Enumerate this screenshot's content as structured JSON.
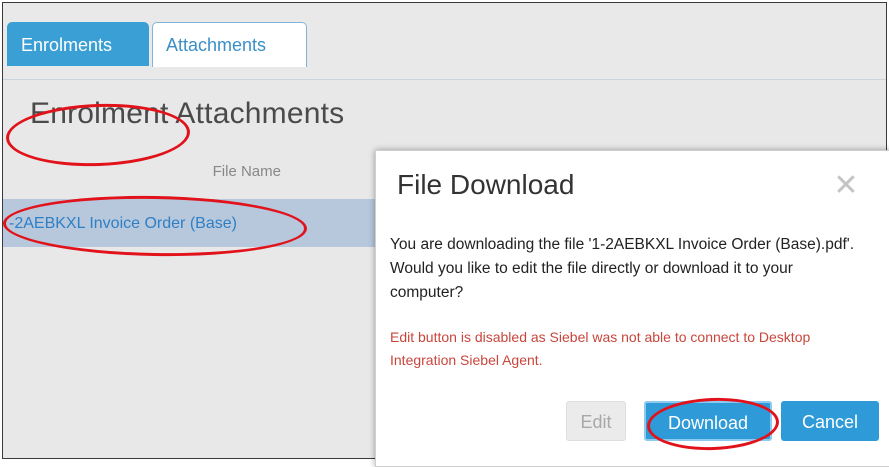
{
  "tabs": [
    {
      "label": "Enrolments",
      "active": true
    },
    {
      "label": "Attachments",
      "active": false
    }
  ],
  "section": {
    "title": "Enrolment Attachments",
    "column_header": "File Name",
    "rows": [
      {
        "file_name": "-2AEBKXL Invoice Order (Base)",
        "selected": true
      }
    ]
  },
  "dialog": {
    "title": "File Download",
    "close_icon": "close-icon",
    "message": "You are downloading the file '1-2AEBKXL Invoice Order (Base).pdf'. Would you like to edit the file directly or download it to your computer?",
    "warning": "Edit button is disabled as Siebel was not able to connect to Desktop Integration Siebel Agent.",
    "buttons": {
      "edit": "Edit",
      "download": "Download",
      "cancel": "Cancel"
    }
  },
  "colors": {
    "accent": "#2f9ad8",
    "selected_row": "#b7c7dc",
    "warning": "#c8463c",
    "annotation": "#e2121b"
  }
}
